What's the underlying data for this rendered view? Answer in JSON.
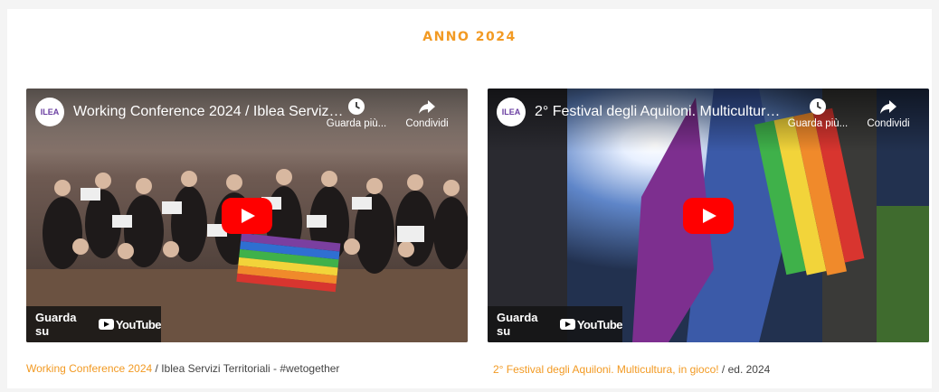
{
  "section": {
    "title": "ANNO 2024"
  },
  "videos": [
    {
      "title": "Working Conference 2024 / Iblea Servizi Territoriali - #wetogether",
      "channel_logo_text": "ILEA",
      "watch_later": "Guarda più...",
      "share": "Condividi",
      "watch_on": "Guarda su",
      "youtube": "YouTube",
      "caption_link": "Working Conference 2024",
      "caption_sep": " / ",
      "caption_rest": "Iblea Servizi Territoriali - #wetogether"
    },
    {
      "title": "2° Festival degli Aquiloni. Multicultura, in gioco!",
      "channel_logo_text": "ILEA",
      "watch_later": "Guarda più...",
      "share": "Condividi",
      "watch_on": "Guarda su",
      "youtube": "YouTube",
      "caption_link": "2° Festival degli Aquiloni. Multicultura, in gioco!",
      "caption_sep": " / ",
      "caption_rest": "ed. 2024"
    }
  ],
  "colors": {
    "accent": "#f29a23",
    "play": "#ff0000"
  },
  "icons": {
    "watch_later": "clock-icon",
    "share": "share-arrow-icon",
    "play": "play-icon",
    "youtube": "youtube-logo-icon"
  }
}
